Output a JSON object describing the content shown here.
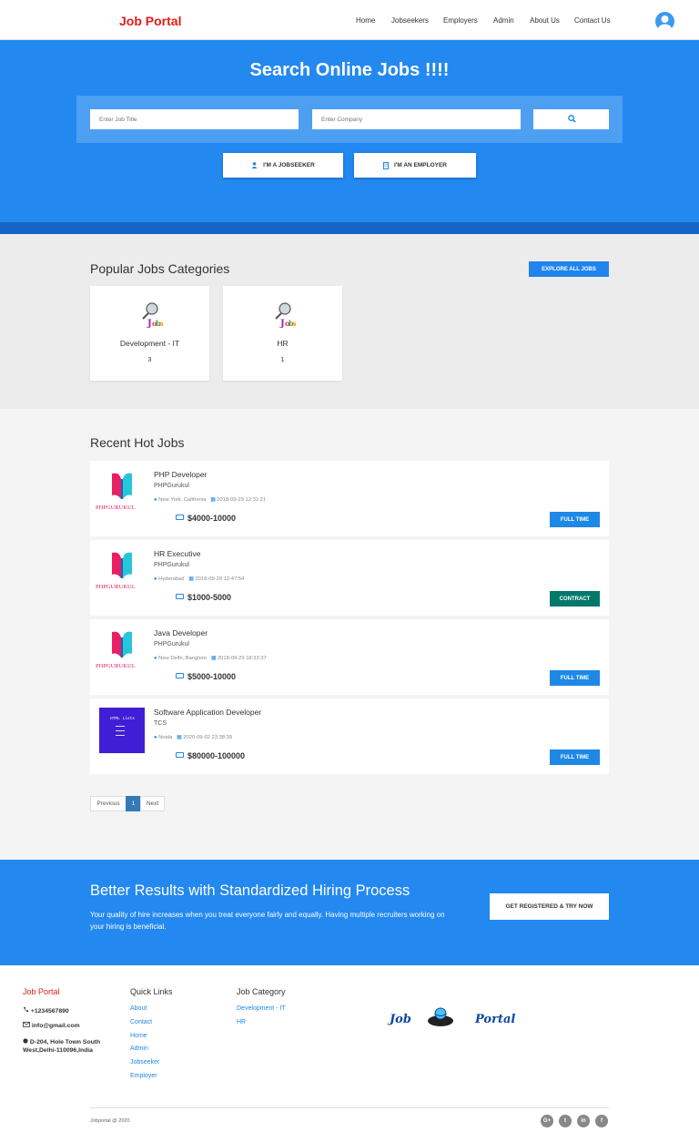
{
  "nav": {
    "brand": "Job Portal",
    "links": [
      "Home",
      "Jobseekers",
      "Employers",
      "Admin",
      "About Us",
      "Contact Us"
    ]
  },
  "hero": {
    "title": "Search Online Jobs !!!!",
    "job_title_placeholder": "Enter Job Title",
    "company_placeholder": "Enter Company",
    "jobseeker_button": "I'M A JOBSEEKER",
    "employer_button": "I'M AN EMPLOYER"
  },
  "categories": {
    "title": "Popular Jobs Categories",
    "explore_button": "EXPLORE ALL JOBS",
    "items": [
      {
        "name": "Development - IT",
        "count": "3"
      },
      {
        "name": "HR",
        "count": "1"
      }
    ]
  },
  "recent": {
    "title": "Recent Hot Jobs",
    "jobs": [
      {
        "title": "PHP Developer",
        "company": "PHPGurukul",
        "location": "New York, California",
        "date": "2018-09-29 12:31:21",
        "salary": "$4000-10000",
        "type": "FULL TIME",
        "type_color": "#1e88e5",
        "logo": "phpgurukul-logo"
      },
      {
        "title": "HR Executive",
        "company": "PHPGurukul",
        "location": "Hyderabad",
        "date": "2018-09-29 12:47:54",
        "salary": "$1000-5000",
        "type": "CONTRACT",
        "type_color": "#00796b",
        "logo": "phpgurukul-logo"
      },
      {
        "title": "Java Developer",
        "company": "PHPGurukul",
        "location": "New Delhi, Banglore",
        "date": "2018-09-29 18:33:37",
        "salary": "$5000-10000",
        "type": "FULL TIME",
        "type_color": "#1e88e5",
        "logo": "phpgurukul-logo"
      },
      {
        "title": "Software Application Developer",
        "company": "TCS",
        "location": "Noida",
        "date": "2020-09-02 23:38:39",
        "salary": "$80000-100000",
        "type": "FULL TIME",
        "type_color": "#1e88e5",
        "logo": "html-lists-logo"
      }
    ],
    "logo_text": "PHPGURUKUL",
    "tcs_logo_text": "HTML Lists"
  },
  "pager": {
    "previous": "Previous",
    "current": "1",
    "next": "Next"
  },
  "promo": {
    "title": "Better Results with Standardized Hiring Process",
    "text": "Your quality of hire increases when you treat everyone fairly and equally. Having multiple recruiters working on your hiring is beneficial.",
    "button": "GET REGISTERED & TRY NOW"
  },
  "footer": {
    "brand": "Job Portal",
    "phone": "+1234567890",
    "email": "info@gmail.com",
    "address": "D-204, Hole Town South West,Delhi-110096,India",
    "quick_links_title": "Quick Links",
    "quick_links": [
      "About",
      "Contact",
      "Home",
      "Admin",
      "Jobseeker",
      "Employer"
    ],
    "category_title": "Job Category",
    "category_links": [
      "Development - IT",
      "HR"
    ],
    "logo_left": "Job",
    "logo_right": "Portal",
    "copyright": "Jobportal @ 2020",
    "social": [
      "G+",
      "t",
      "in",
      "f"
    ]
  },
  "colors": {
    "brand_red": "#e41b17",
    "primary_blue": "#2388f0"
  }
}
